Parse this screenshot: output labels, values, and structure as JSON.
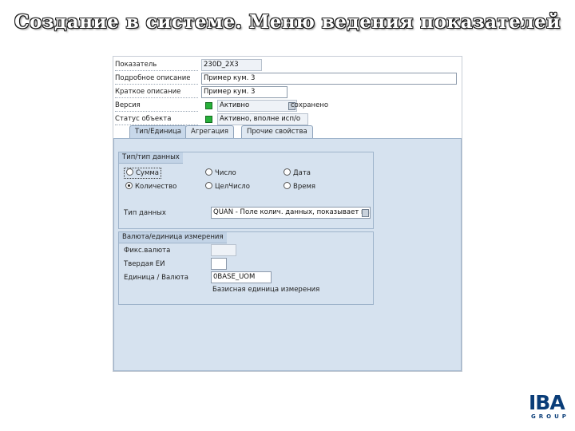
{
  "page": {
    "title": "Создание в системе. Меню ведения показателей"
  },
  "header_fields": [
    {
      "label": "Показатель",
      "value": "230D_2X3"
    },
    {
      "label": "Подробное описание",
      "value": "Пример кум. 3"
    },
    {
      "label": "Краткое описание",
      "value": "Пример кум. 3"
    },
    {
      "label": "Версия",
      "value": "Активно",
      "extra": "сохранено"
    },
    {
      "label": "Статус объекта",
      "value": "Активно, вполне исп/о"
    }
  ],
  "tabs": [
    {
      "label": "Тип/Единица"
    },
    {
      "label": "Агрегация"
    },
    {
      "label": "Прочие свойства"
    }
  ],
  "group_type": {
    "title": "Тип/тип данных",
    "radios": [
      {
        "label": "Сумма",
        "selected": false
      },
      {
        "label": "Число",
        "selected": false
      },
      {
        "label": "Дата",
        "selected": false
      },
      {
        "label": "Количество",
        "selected": true
      },
      {
        "label": "ЦелЧисло",
        "selected": false
      },
      {
        "label": "Время",
        "selected": false
      }
    ],
    "data_type_label": "Тип данных",
    "data_type_value": "QUAN - Поле колич. данных, показывает на"
  },
  "group_unit": {
    "title": "Валюта/единица измерения",
    "fixed_currency_label": "Фикс.валюта",
    "fixed_unit_label": "Твердая ЕИ",
    "unit_currency_label": "Единица / Валюта",
    "unit_currency_value": "0BASE_UOM",
    "unit_currency_desc": "Базисная единица измерения"
  },
  "logo": {
    "big": "IBA",
    "small": "GROUP"
  },
  "colors": {
    "panel": "#d6e2ef",
    "group_header": "#c2d3e6",
    "logo": "#0a3d78",
    "status_green": "#27b03a"
  }
}
